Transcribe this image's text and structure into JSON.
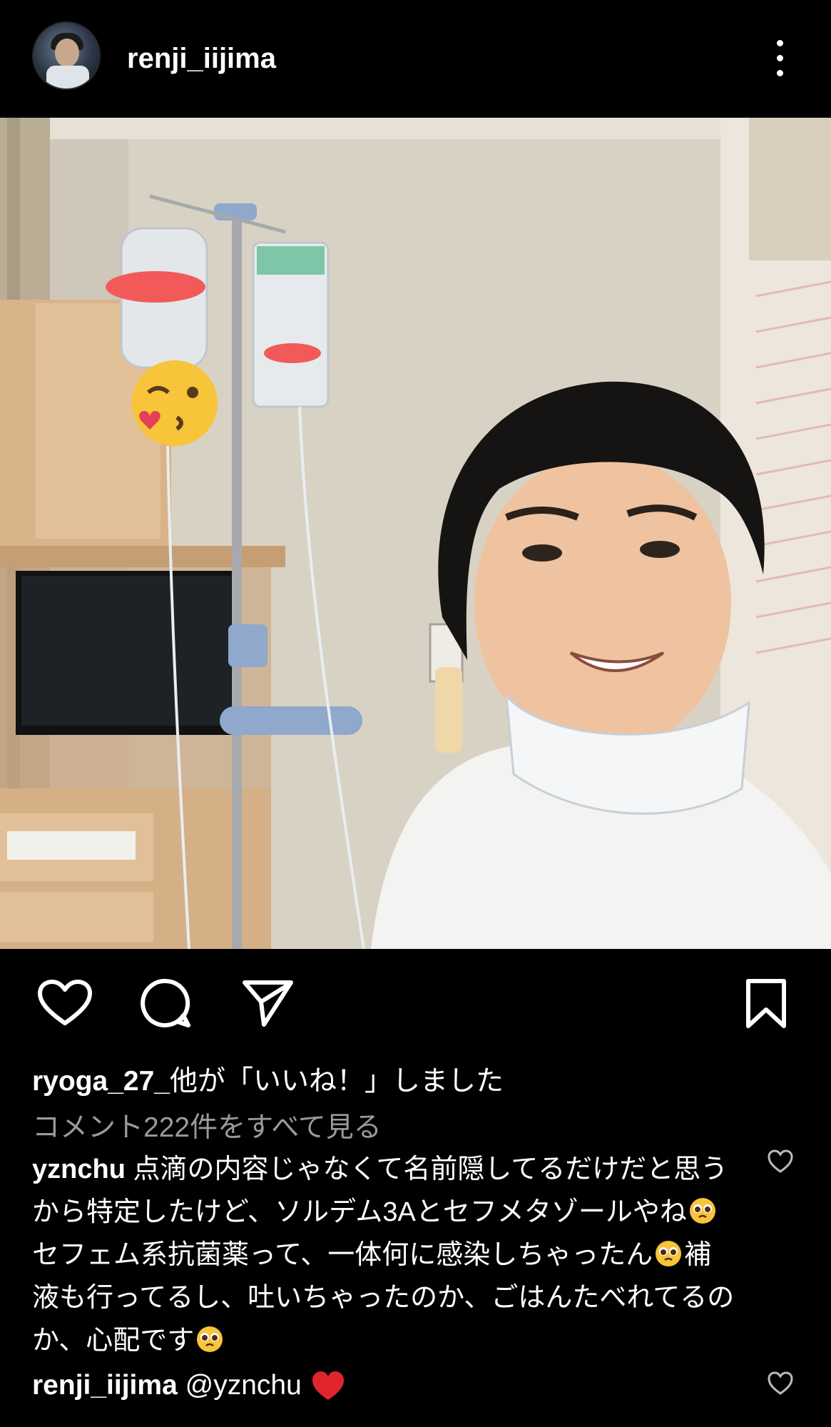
{
  "header": {
    "username": "renji_iijima"
  },
  "post": {
    "icons": [
      "heart-icon",
      "comment-icon",
      "share-icon",
      "bookmark-icon"
    ]
  },
  "likes": {
    "user": "ryoga_27_",
    "text": "他が「いいね！」しました"
  },
  "comments_link": "コメント222件をすべて見る",
  "comment": {
    "user": "yznchu",
    "parts": [
      "点滴の内容じゃなくて名前隠してるだけだと思うから特定したけど、ソルデム3Aとセフメタゾールやね",
      "セフェム系抗菌薬って、一体何に感染しちゃったん",
      "補液も行ってるし、吐いちゃったのか、ごはんたべれてるのか、心配です"
    ],
    "emoji": "pleading-face-emoji"
  },
  "reply": {
    "user": "renji_iijima",
    "mention": "@yznchu",
    "emoji": "red-heart-emoji"
  },
  "colors": {
    "background": "#000000",
    "text": "#ffffff",
    "muted": "#9a9a9a",
    "heart_red": "#e0252f"
  }
}
